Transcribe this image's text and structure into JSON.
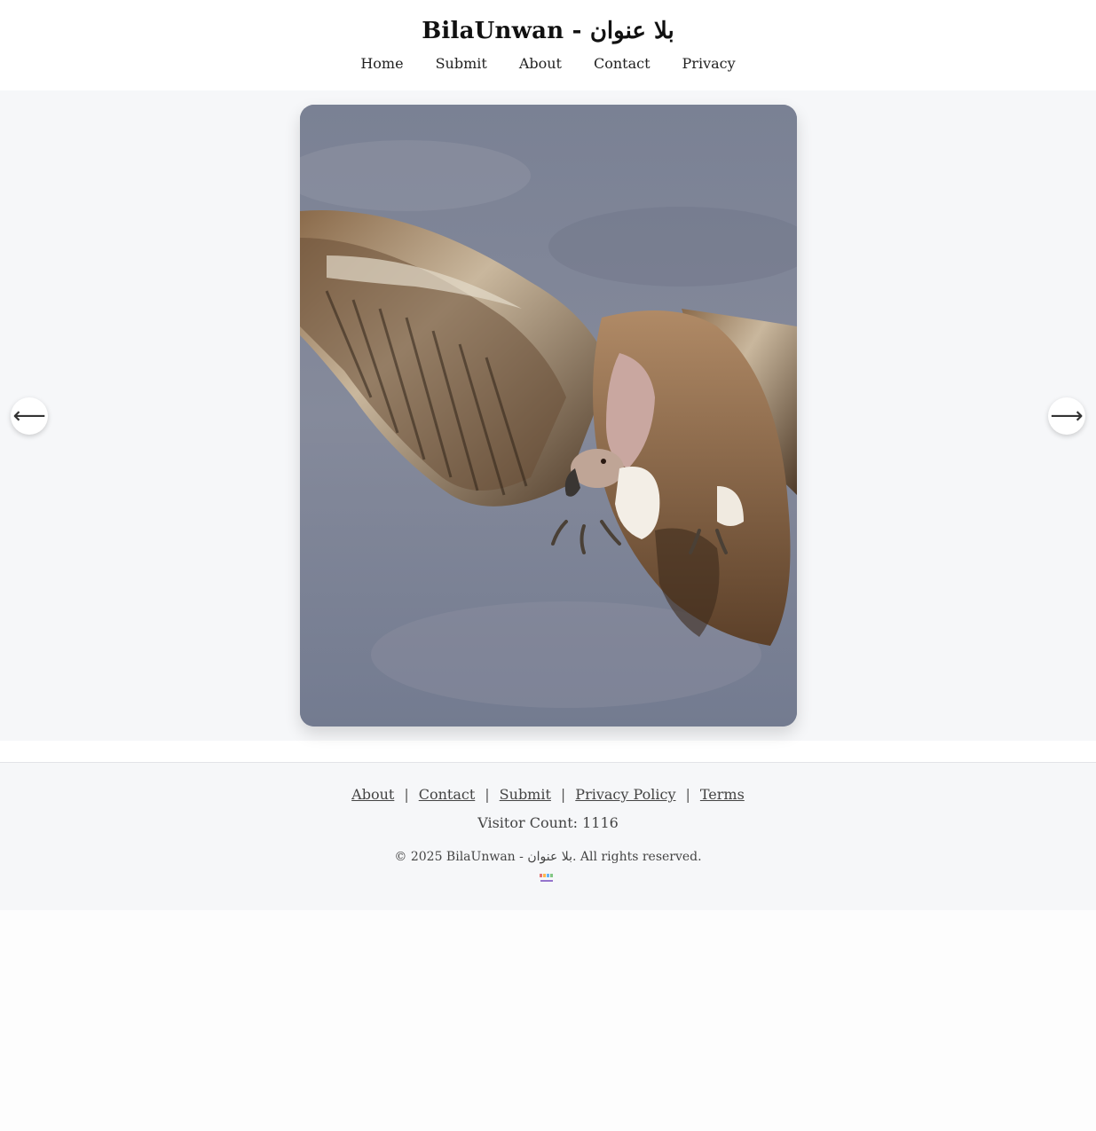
{
  "header": {
    "title": "BilaUnwan - بلا عنوان",
    "nav": [
      "Home",
      "Submit",
      "About",
      "Contact",
      "Privacy"
    ]
  },
  "carousel": {
    "prev_glyph": "⟵",
    "next_glyph": "⟶",
    "image_subject": "vulture-in-flight"
  },
  "footer": {
    "links": [
      "About",
      "Contact",
      "Submit",
      "Privacy Policy",
      "Terms"
    ],
    "separator": "|",
    "visitor_count": "Visitor Count: 1116",
    "copyright": "© 2025 BilaUnwan - بلا عنوان. All rights reserved."
  },
  "colors": {
    "page_bg": "#f6f7f9",
    "header_bg": "#ffffff",
    "text": "#222222",
    "sky": "#7c8494"
  }
}
